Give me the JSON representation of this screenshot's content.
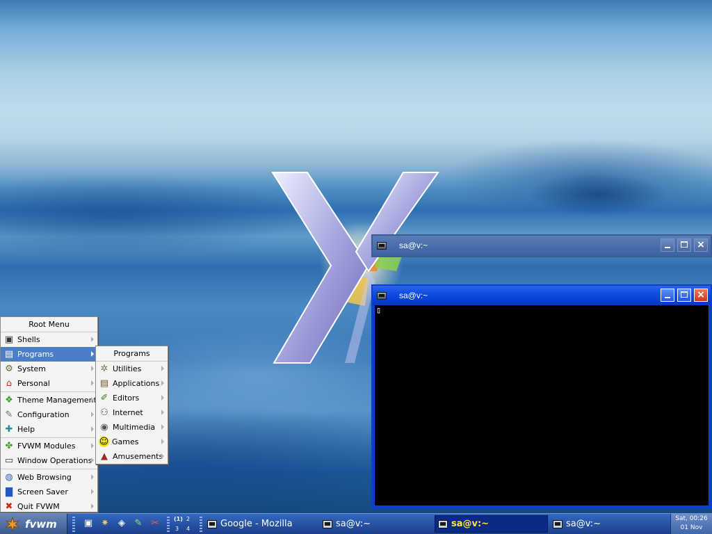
{
  "desktop": {
    "colors": {
      "sky": "#bfdcec",
      "water": "#2e6fb0"
    }
  },
  "windows": [
    {
      "title": "sa@v:~",
      "state": "inactive",
      "buttons": {
        "minimize": "minimize",
        "maximize": "maximize",
        "close": "×"
      }
    },
    {
      "title": "sa@v:~",
      "state": "active",
      "buttons": {
        "minimize": "minimize",
        "maximize": "maximize",
        "close": "×"
      },
      "terminal": {
        "cursor": "▯"
      }
    }
  ],
  "root_menu": {
    "title": "Root Menu",
    "items": [
      {
        "label": "Shells",
        "icon": "terminal-icon",
        "glyph": "▣"
      },
      {
        "label": "Programs",
        "icon": "programs-icon",
        "glyph": "▤"
      },
      {
        "label": "System",
        "icon": "gear-icon",
        "glyph": "⚙"
      },
      {
        "label": "Personal",
        "icon": "home-icon",
        "glyph": "⌂"
      },
      {
        "label": "Theme Management",
        "icon": "gift-icon",
        "glyph": "❖"
      },
      {
        "label": "Configuration",
        "icon": "wrench-icon",
        "glyph": "✎"
      },
      {
        "label": "Help",
        "icon": "help-icon",
        "glyph": "✚"
      },
      {
        "label": "FVWM Modules",
        "icon": "puzzle-icon",
        "glyph": "✤"
      },
      {
        "label": "Window Operations",
        "icon": "window-icon",
        "glyph": "▭"
      },
      {
        "label": "Web Browsing",
        "icon": "globe-icon",
        "glyph": "◍"
      },
      {
        "label": "Screen Saver",
        "icon": "monitor-icon",
        "glyph": "▇"
      },
      {
        "label": "Quit FVWM",
        "icon": "quit-icon",
        "glyph": "✖"
      }
    ]
  },
  "programs_menu": {
    "title": "Programs",
    "items": [
      {
        "label": "Utilities",
        "icon": "utilities-icon",
        "glyph": "✲"
      },
      {
        "label": "Applications",
        "icon": "applications-icon",
        "glyph": "▤"
      },
      {
        "label": "Editors",
        "icon": "pencil-icon",
        "glyph": "✐"
      },
      {
        "label": "Internet",
        "icon": "network-icon",
        "glyph": "⚇"
      },
      {
        "label": "Multimedia",
        "icon": "multimedia-icon",
        "glyph": "◉"
      },
      {
        "label": "Games",
        "icon": "smiley-icon",
        "glyph": "☺"
      },
      {
        "label": "Amusements",
        "icon": "amusements-icon",
        "glyph": "▲"
      }
    ]
  },
  "taskbar": {
    "start_label": "fvwm",
    "launchers": [
      {
        "icon": "terminal-launcher-icon",
        "glyph": "▣"
      },
      {
        "icon": "settings-launcher-icon",
        "glyph": "✷"
      },
      {
        "icon": "package-launcher-icon",
        "glyph": "◈"
      },
      {
        "icon": "editor-launcher-icon",
        "glyph": "✎"
      },
      {
        "icon": "browser-launcher-icon",
        "glyph": "✂"
      }
    ],
    "pager": {
      "d1": "(1)",
      "d2": "2",
      "d3": "3",
      "d4": "4"
    },
    "tasks": [
      {
        "label": "Google - Mozilla",
        "active": false
      },
      {
        "label": "sa@v:~",
        "active": false
      },
      {
        "label": "sa@v:~",
        "active": true
      },
      {
        "label": "sa@v:~",
        "active": false
      }
    ],
    "clock": {
      "time": "Sat, 00:26",
      "date": "01 Nov"
    }
  }
}
